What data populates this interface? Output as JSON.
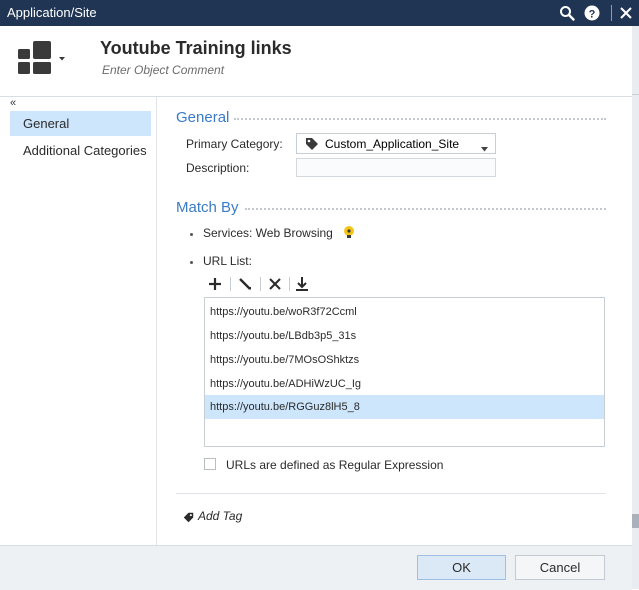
{
  "window": {
    "title": "Application/Site"
  },
  "object": {
    "title": "Youtube Training links",
    "comment_placeholder": "Enter Object Comment"
  },
  "nav": {
    "collapse": "«",
    "items": [
      {
        "label": "General"
      },
      {
        "label": "Additional Categories"
      }
    ]
  },
  "general": {
    "section_title": "General",
    "primary_category_label": "Primary Category:",
    "primary_category_value": "Custom_Application_Site",
    "description_label": "Description:"
  },
  "match_by": {
    "section_title": "Match By",
    "services_label": "Services: Web Browsing",
    "url_list_label": "URL List:",
    "urls": [
      "https://youtu.be/woR3f72Ccml",
      "https://youtu.be/LBdb3p5_31s",
      "https://youtu.be/7MOsOShktzs",
      "https://youtu.be/ADHiWzUC_Ig",
      "https://youtu.be/RGGuz8lH5_8"
    ],
    "regex_label": "URLs are defined as Regular Expression"
  },
  "tags": {
    "add_tag_label": "Add Tag"
  },
  "footer": {
    "ok_label": "OK",
    "cancel_label": "Cancel"
  },
  "colors": {
    "titlebar": "#1f3553",
    "accent": "#3a7bc8",
    "selection": "#cde6fb"
  }
}
